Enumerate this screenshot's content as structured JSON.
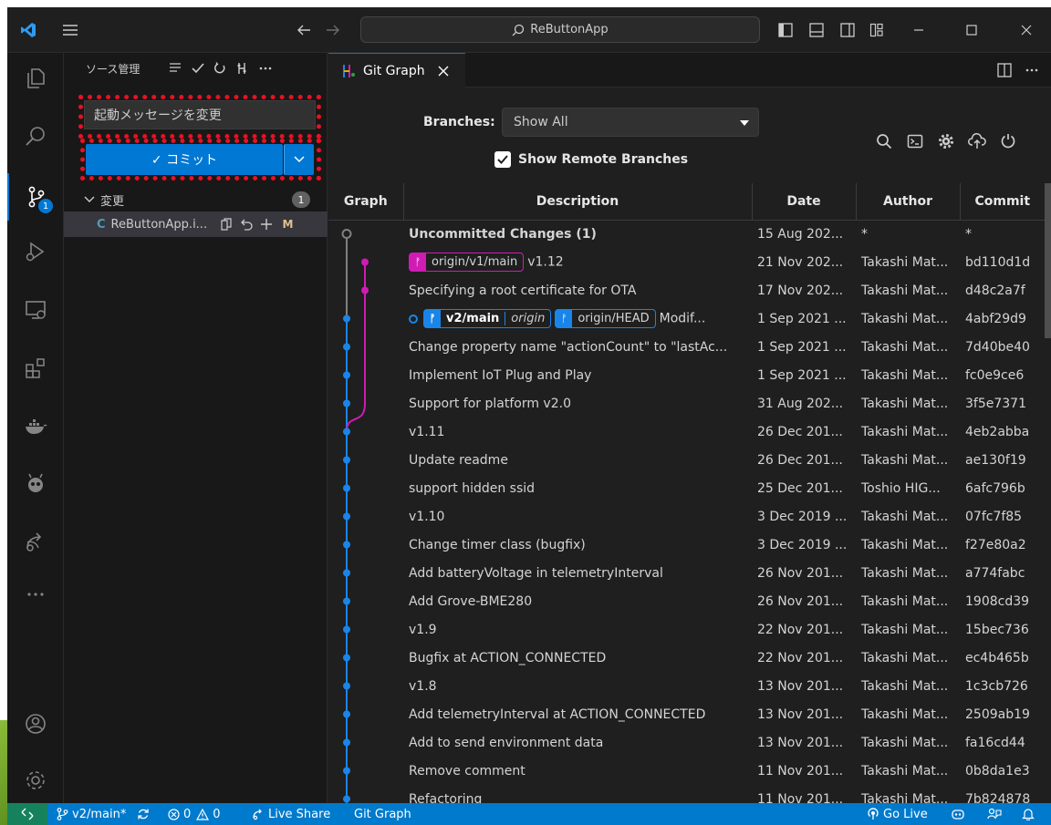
{
  "titlebar": {
    "search_text": "ReButtonApp"
  },
  "activity": {
    "scm_badge": "1"
  },
  "sidebar": {
    "title": "ソース管理",
    "commit_message": "起動メッセージを変更",
    "commit_label": "✓ コミット",
    "changes_label": "変更",
    "changes_count": "1",
    "file_name": "ReButtonApp.i...",
    "file_status": "M"
  },
  "editor": {
    "tab_label": "Git Graph",
    "branches_label": "Branches:",
    "branches_value": "Show All",
    "show_remote_label": "Show Remote Branches"
  },
  "table": {
    "columns": [
      "Graph",
      "Description",
      "Date",
      "Author",
      "Commit"
    ],
    "rows": [
      {
        "desc": "Uncommitted Changes (1)",
        "date": "15 Aug 202...",
        "author": "*",
        "commit": "*"
      },
      {
        "desc": "v1.12",
        "date": "21 Nov 202...",
        "author": "Takashi Mat...",
        "commit": "bd110d1d"
      },
      {
        "desc": "Specifying a root certificate for OTA",
        "date": "17 Nov 202...",
        "author": "Takashi Mat...",
        "commit": "d48c2a7f"
      },
      {
        "desc": "Modif...",
        "date": "1 Sep 2021 ...",
        "author": "Takashi Mat...",
        "commit": "4abf29d9"
      },
      {
        "desc": "Change property name \"actionCount\" to \"lastAc...",
        "date": "1 Sep 2021 ...",
        "author": "Takashi Mat...",
        "commit": "7d40be40"
      },
      {
        "desc": "Implement IoT Plug and Play",
        "date": "1 Sep 2021 ...",
        "author": "Takashi Mat...",
        "commit": "fc0e9ce6"
      },
      {
        "desc": "Support for platform v2.0",
        "date": "31 Aug 202...",
        "author": "Takashi Mat...",
        "commit": "3f5e7371"
      },
      {
        "desc": "v1.11",
        "date": "26 Dec 201...",
        "author": "Takashi Mat...",
        "commit": "4eb2abba"
      },
      {
        "desc": "Update readme",
        "date": "26 Dec 201...",
        "author": "Takashi Mat...",
        "commit": "ae130f19"
      },
      {
        "desc": "support hidden ssid",
        "date": "25 Dec 201...",
        "author": "Toshio HIG...",
        "commit": "6afc796b"
      },
      {
        "desc": "v1.10",
        "date": "3 Dec 2019 ...",
        "author": "Takashi Mat...",
        "commit": "07fc7f85"
      },
      {
        "desc": "Change timer class (bugfix)",
        "date": "3 Dec 2019 ...",
        "author": "Takashi Mat...",
        "commit": "f27e80a2"
      },
      {
        "desc": "Add batteryVoltage in telemetryInterval",
        "date": "26 Nov 201...",
        "author": "Takashi Mat...",
        "commit": "a774fabc"
      },
      {
        "desc": "Add Grove-BME280",
        "date": "26 Nov 201...",
        "author": "Takashi Mat...",
        "commit": "1908cd39"
      },
      {
        "desc": "v1.9",
        "date": "22 Nov 201...",
        "author": "Takashi Mat...",
        "commit": "15bec736"
      },
      {
        "desc": "Bugfix at ACTION_CONNECTED",
        "date": "22 Nov 201...",
        "author": "Takashi Mat...",
        "commit": "ec4b465b"
      },
      {
        "desc": "v1.8",
        "date": "13 Nov 201...",
        "author": "Takashi Mat...",
        "commit": "1c3cb726"
      },
      {
        "desc": "Add telemetryInterval at ACTION_CONNECTED",
        "date": "13 Nov 201...",
        "author": "Takashi Mat...",
        "commit": "2509ab19"
      },
      {
        "desc": "Add to send environment data",
        "date": "13 Nov 201...",
        "author": "Takashi Mat...",
        "commit": "fa16cd44"
      },
      {
        "desc": "Remove comment",
        "date": "11 Nov 201...",
        "author": "Takashi Mat...",
        "commit": "0b8da1e3"
      },
      {
        "desc": "Refactoring",
        "date": "11 Nov 201...",
        "author": "Takashi Mat...",
        "commit": "7b824878"
      }
    ],
    "refs": {
      "origin_v1": "origin/v1/main",
      "v2_main": "v2/main",
      "v2_remote": "origin",
      "origin_head": "origin/HEAD"
    }
  },
  "statusbar": {
    "branch": "v2/main*",
    "errors": "0",
    "warnings": "0",
    "live_share": "Live Share",
    "git_graph": "Git Graph",
    "go_live": "Go Live"
  },
  "colors": {
    "accent": "#0078d4",
    "graph_blue": "#1a85e8",
    "graph_magenta": "#d01bb4",
    "statusbar": "#007acc",
    "highlight": "#e81123"
  }
}
